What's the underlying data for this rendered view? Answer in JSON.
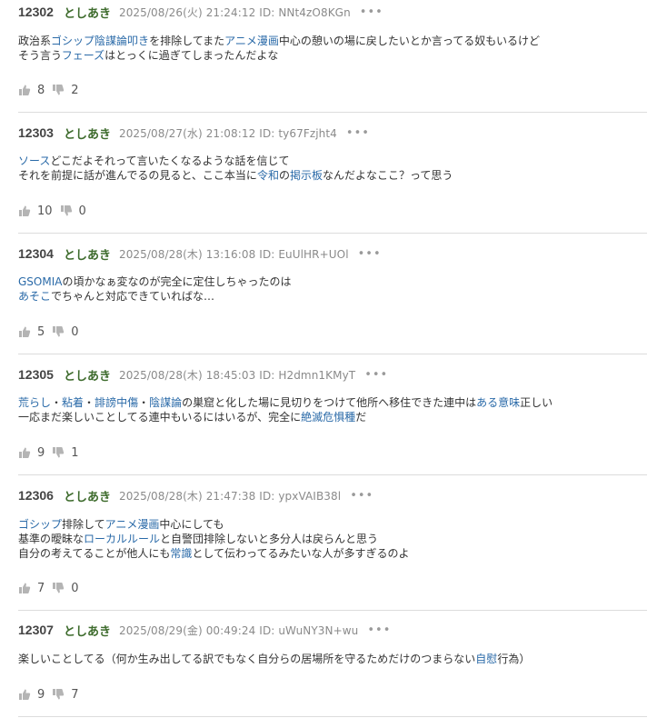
{
  "posts": [
    {
      "number": "12302",
      "author": "としあき",
      "date": "2025/08/26(火) 21:24:12 ID: NNt4zO8KGn",
      "menu": "•••",
      "lines": [
        [
          {
            "text": "政治系",
            "link": false
          },
          {
            "text": "ゴシップ",
            "link": true
          },
          {
            "text": "陰謀論",
            "link": true
          },
          {
            "text": "叩き",
            "link": true
          },
          {
            "text": "を排除してまた",
            "link": false
          },
          {
            "text": "アニメ漫画",
            "link": true
          },
          {
            "text": "中心の憩いの場に戻したいとか言ってる奴もいるけど",
            "link": false
          }
        ],
        [
          {
            "text": "そう言う",
            "link": false
          },
          {
            "text": "フェーズ",
            "link": true
          },
          {
            "text": "はとっくに過ぎてしまったんだよな",
            "link": false
          }
        ]
      ],
      "likes": "8",
      "dislikes": "2"
    },
    {
      "number": "12303",
      "author": "としあき",
      "date": "2025/08/27(水) 21:08:12 ID: ty67Fzjht4",
      "menu": "•••",
      "lines": [
        [
          {
            "text": "ソース",
            "link": true
          },
          {
            "text": "どこだよそれって言いたくなるような話を信じて",
            "link": false
          }
        ],
        [
          {
            "text": "それを前提に話が進んでるの見ると、ここ本当に",
            "link": false
          },
          {
            "text": "令和",
            "link": true
          },
          {
            "text": "の",
            "link": false
          },
          {
            "text": "掲示板",
            "link": true
          },
          {
            "text": "なんだよなここ？って思う",
            "link": false
          }
        ]
      ],
      "likes": "10",
      "dislikes": "0"
    },
    {
      "number": "12304",
      "author": "としあき",
      "date": "2025/08/28(木) 13:16:08 ID: EuUlHR+UOl",
      "menu": "•••",
      "lines": [
        [
          {
            "text": "GSOMIA",
            "link": true
          },
          {
            "text": "の頃かなぁ変なのが完全に定住しちゃったのは",
            "link": false
          }
        ],
        [
          {
            "text": "あそこ",
            "link": true
          },
          {
            "text": "でちゃんと対応できていればな…",
            "link": false
          }
        ]
      ],
      "likes": "5",
      "dislikes": "0"
    },
    {
      "number": "12305",
      "author": "としあき",
      "date": "2025/08/28(木) 18:45:03 ID: H2dmn1KMyT",
      "menu": "•••",
      "lines": [
        [
          {
            "text": "荒らし",
            "link": true
          },
          {
            "text": "・",
            "link": false
          },
          {
            "text": "粘着",
            "link": true
          },
          {
            "text": "・",
            "link": false
          },
          {
            "text": "誹謗中傷",
            "link": true
          },
          {
            "text": "・",
            "link": false
          },
          {
            "text": "陰謀論",
            "link": true
          },
          {
            "text": "の巣窟と化した場に見切りをつけて他所へ移住できた連中は",
            "link": false
          },
          {
            "text": "ある意味",
            "link": true
          },
          {
            "text": "正しい",
            "link": false
          }
        ],
        [
          {
            "text": "一応まだ楽しいことしてる連中もいるにはいるが、完全に",
            "link": false
          },
          {
            "text": "絶滅危惧種",
            "link": true
          },
          {
            "text": "だ",
            "link": false
          }
        ]
      ],
      "likes": "9",
      "dislikes": "1"
    },
    {
      "number": "12306",
      "author": "としあき",
      "date": "2025/08/28(木) 21:47:38 ID: ypxVAIB38l",
      "menu": "•••",
      "lines": [
        [
          {
            "text": "ゴシップ",
            "link": true
          },
          {
            "text": "排除して",
            "link": false
          },
          {
            "text": "アニメ漫画",
            "link": true
          },
          {
            "text": "中心にしても",
            "link": false
          }
        ],
        [
          {
            "text": "基準の曖昧な",
            "link": false
          },
          {
            "text": "ローカルルール",
            "link": true
          },
          {
            "text": "と自警団排除しないと多分人は戻らんと思う",
            "link": false
          }
        ],
        [
          {
            "text": "自分の考えてることが他人にも",
            "link": false
          },
          {
            "text": "常識",
            "link": true
          },
          {
            "text": "として伝わってるみたいな人が多すぎるのよ",
            "link": false
          }
        ]
      ],
      "likes": "7",
      "dislikes": "0"
    },
    {
      "number": "12307",
      "author": "としあき",
      "date": "2025/08/29(金) 00:49:24 ID: uWuNY3N+wu",
      "menu": "•••",
      "lines": [
        [
          {
            "text": "楽しいことしてる（何か生み出してる訳でもなく自分らの居場所を守るためだけのつまらない",
            "link": false
          },
          {
            "text": "自慰",
            "link": true
          },
          {
            "text": "行為）",
            "link": false
          }
        ]
      ],
      "likes": "9",
      "dislikes": "7"
    }
  ],
  "icons": {
    "like": "thumbs-up-icon",
    "dislike": "thumbs-down-icon",
    "menu": "more-options-icon"
  },
  "colors": {
    "author": "#3d6b2c",
    "link": "#2a6aa8",
    "meta": "#8a8a8a",
    "separator": "#dcdcdc"
  }
}
